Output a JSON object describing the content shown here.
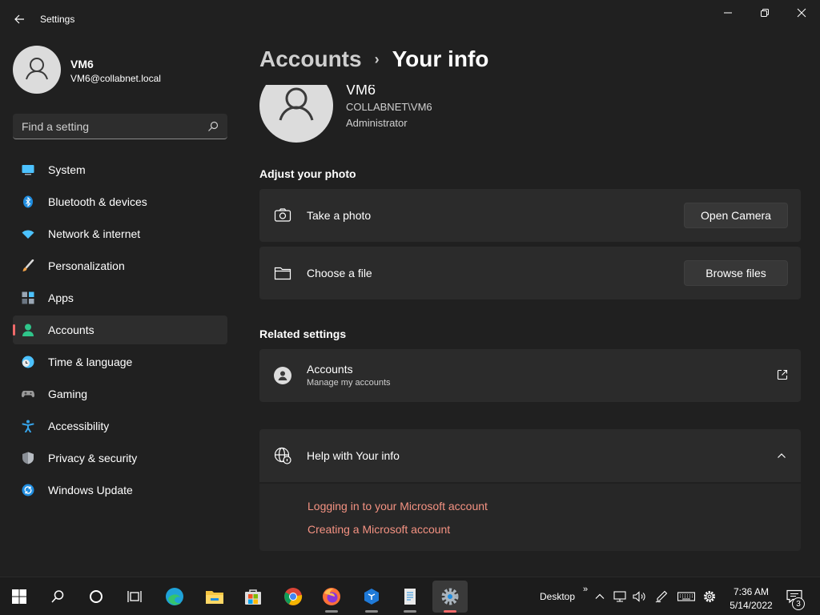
{
  "window": {
    "title": "Settings",
    "controls": [
      "minimize",
      "maximize",
      "close"
    ]
  },
  "user": {
    "name": "VM6",
    "email": "VM6@collabnet.local"
  },
  "search": {
    "placeholder": "Find a setting",
    "value": ""
  },
  "sidebar": {
    "items": [
      {
        "label": "System",
        "icon": "system-icon",
        "color": "#4cc2ff"
      },
      {
        "label": "Bluetooth & devices",
        "icon": "bluetooth-icon",
        "color": "#1f8de0"
      },
      {
        "label": "Network & internet",
        "icon": "wifi-icon",
        "color": "#4cc2ff"
      },
      {
        "label": "Personalization",
        "icon": "brush-icon",
        "color": "#f0a24a"
      },
      {
        "label": "Apps",
        "icon": "apps-icon",
        "color": "#9aa7b5"
      },
      {
        "label": "Accounts",
        "icon": "person-icon",
        "color": "#2fc58a",
        "active": true
      },
      {
        "label": "Time & language",
        "icon": "clock-globe-icon",
        "color": "#4cc2ff"
      },
      {
        "label": "Gaming",
        "icon": "gamepad-icon",
        "color": "#9a9a9a"
      },
      {
        "label": "Accessibility",
        "icon": "accessibility-icon",
        "color": "#36a3e8"
      },
      {
        "label": "Privacy & security",
        "icon": "shield-icon",
        "color": "#8a8f96"
      },
      {
        "label": "Windows Update",
        "icon": "update-icon",
        "color": "#1f8de0"
      }
    ]
  },
  "main": {
    "breadcrumb_parent": "Accounts",
    "breadcrumb_current": "Your info",
    "profile": {
      "name": "VM6",
      "domain": "COLLABNET\\VM6",
      "role": "Administrator"
    },
    "adjust_photo": {
      "title": "Adjust your photo",
      "take_photo_label": "Take a photo",
      "open_camera_label": "Open Camera",
      "choose_file_label": "Choose a file",
      "browse_files_label": "Browse files"
    },
    "related": {
      "title": "Related settings",
      "accounts_label": "Accounts",
      "accounts_sub": "Manage my accounts"
    },
    "help": {
      "title": "Help with Your info",
      "links": [
        "Logging in to your Microsoft account",
        "Creating a Microsoft account"
      ]
    }
  },
  "taskbar": {
    "apps": [
      "start",
      "search",
      "cortana",
      "task-view",
      "edge",
      "file-explorer",
      "store",
      "chrome",
      "firefox",
      "app",
      "notepad",
      "settings"
    ],
    "active_app": "settings",
    "desktop_label": "Desktop",
    "time": "7:36 AM",
    "date": "5/14/2022",
    "notification_count": "3",
    "accent": "#f06a6a"
  },
  "colors": {
    "background": "#202020",
    "card": "#2b2b2b",
    "accent": "#f06a6a",
    "link": "#f49282"
  }
}
